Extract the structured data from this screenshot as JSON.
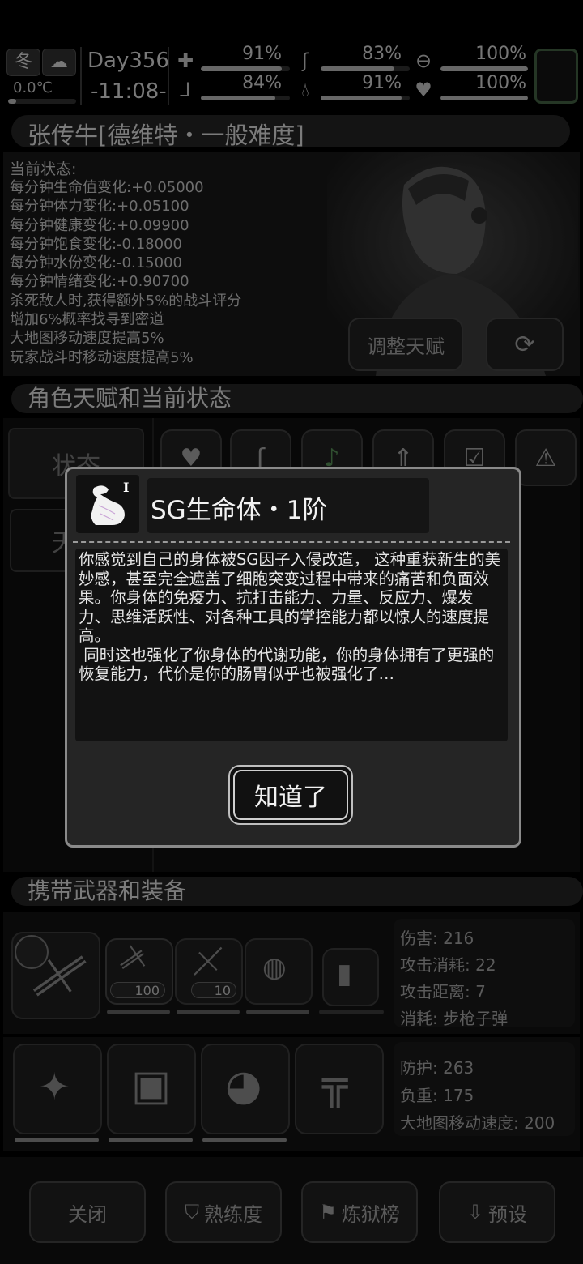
{
  "status_bar": {
    "season": "冬",
    "temperature": "0.0℃",
    "day": "Day356",
    "time": "-11:08-",
    "stats": [
      {
        "name": "health",
        "icon": "medkit-icon",
        "value": "91%",
        "level": 0.91
      },
      {
        "name": "hunger",
        "icon": "stomach-icon",
        "value": "83%",
        "level": 0.83
      },
      {
        "name": "mental",
        "icon": "brain-icon",
        "value": "100%",
        "level": 1.0
      },
      {
        "name": "stamina",
        "icon": "boot-icon",
        "value": "84%",
        "level": 0.84
      },
      {
        "name": "water",
        "icon": "water-drop-icon",
        "value": "91%",
        "level": 0.91
      },
      {
        "name": "mood",
        "icon": "heart-icon",
        "value": "100%",
        "level": 1.0
      }
    ]
  },
  "character": {
    "name_line": "张传牛[德维特・一般难度]",
    "state_title": "当前状态:",
    "state_lines": [
      "每分钟生命值变化:+0.05000",
      "每分钟体力变化:+0.05100",
      "每分钟健康变化:+0.09900",
      "每分钟饱食变化:-0.18000",
      "每分钟水份变化:-0.15000",
      "每分钟情绪变化:+0.90700",
      "杀死敌人时,获得额外5%的战斗评分",
      "增加6%概率找寻到密道",
      "大地图移动速度提高5%",
      "玩家战斗时移动速度提高5%"
    ],
    "adjust_talent": "调整天赋"
  },
  "talent_section": {
    "title": "角色天赋和当前状态",
    "tab_status": "状态",
    "tab_talent": "天"
  },
  "weapons_section": {
    "title": "携带武器和装备",
    "weapon_counts": [
      "100",
      "10"
    ],
    "weapon_stats": [
      "伤害: 216",
      "攻击消耗: 22",
      "攻击距离: 7",
      "消耗: 步枪子弹"
    ],
    "armor_stats": [
      "防护: 263",
      "负重: 175",
      "大地图移动速度: 200"
    ]
  },
  "bottom_buttons": {
    "close": "关闭",
    "proficiency": "熟练度",
    "ranking": "炼狱榜",
    "preset": "预设"
  },
  "modal": {
    "badge": "I",
    "title": "SG生命体・1阶",
    "body": "你感觉到自己的身体被SG因子入侵改造， 这种重获新生的美妙感，甚至完全遮盖了细胞突变过程中带来的痛苦和负面效果。你身体的免疫力、抗打击能力、力量、反应力、爆发力、思维活跃性、对各种工具的掌控能力都以惊人的速度提高。\n 同时这也强化了你身体的代谢功能，你的身体拥有了更强的恢复能力，代价是你的肠胃似乎也被强化了…",
    "ok_button": "知道了"
  }
}
